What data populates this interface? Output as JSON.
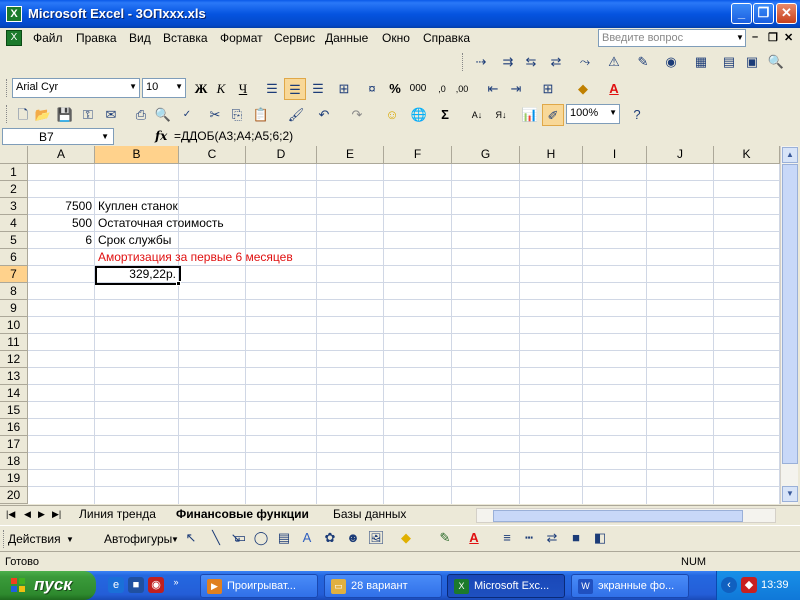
{
  "window": {
    "title": "Microsoft Excel - 3OПxxx.xls"
  },
  "menu": {
    "items": [
      "Файл",
      "Правка",
      "Вид",
      "Вставка",
      "Формат",
      "Сервис",
      "Данные",
      "Окно",
      "Справка"
    ],
    "ask_placeholder": "Введите вопрос"
  },
  "formatting": {
    "font": "Arial Cyr",
    "size": "10"
  },
  "standard": {
    "zoom": "100%"
  },
  "formula_bar": {
    "name_box": "B7",
    "fx": "fx",
    "formula": "=ДДОБ(A3;A4;A5;6;2)"
  },
  "grid": {
    "columns": [
      "A",
      "B",
      "C",
      "D",
      "E",
      "F",
      "G",
      "H",
      "I",
      "J",
      "K"
    ],
    "rows": [
      "1",
      "2",
      "3",
      "4",
      "5",
      "6",
      "7",
      "8",
      "9",
      "10",
      "11",
      "12",
      "13",
      "14",
      "15",
      "16",
      "17",
      "18",
      "19",
      "20"
    ],
    "cells": {
      "a3": "7500",
      "b3": "Куплен станок",
      "a4": "500",
      "b4": "Остаточная стоимость",
      "a5": "6",
      "b5": "Срок службы",
      "b6": "Амортизация за первые 6 месяцев",
      "b7": "329,22р."
    }
  },
  "sheets": {
    "tabs": [
      "Линия тренда",
      "Финансовые функции",
      "Базы данных"
    ],
    "active": "Финансовые функции"
  },
  "drawing": {
    "actions": "Действия",
    "autoshapes": "Автофигуры"
  },
  "status": {
    "ready": "Готово",
    "num": "NUM"
  },
  "taskbar": {
    "start": "пуск",
    "tasks": [
      "Проигрыват...",
      "28 вариант",
      "Microsoft Exc...",
      "экранные фо..."
    ],
    "clock": "13:39"
  },
  "colors": {
    "accent_red": "#e01010",
    "selection_header": "#ffd28c",
    "title_blue": "#0554e0"
  }
}
